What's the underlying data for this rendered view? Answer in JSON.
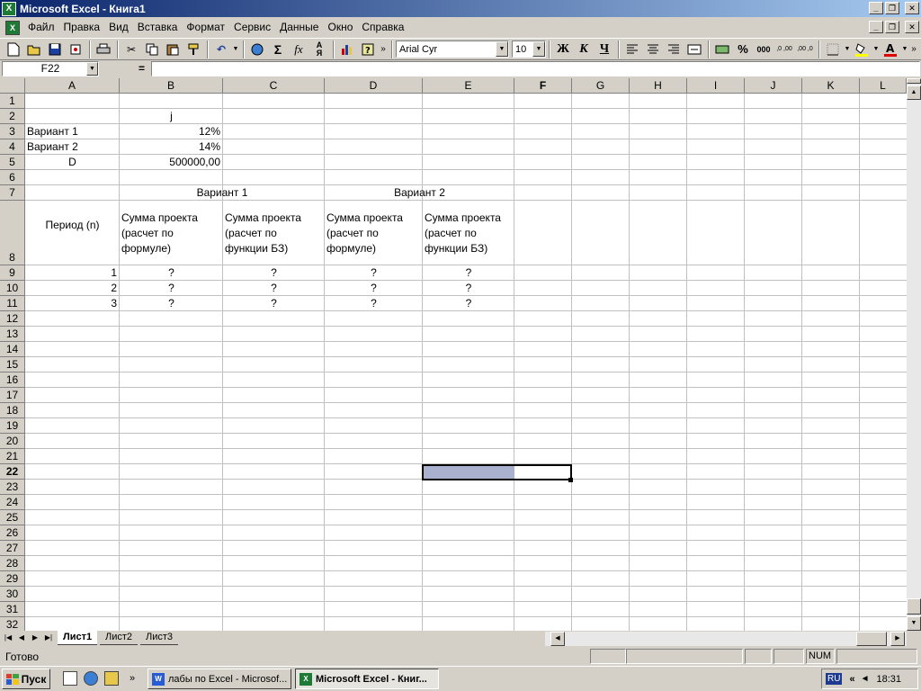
{
  "window": {
    "title": "Microsoft Excel - Книга1"
  },
  "menu": {
    "items": [
      "Файл",
      "Правка",
      "Вид",
      "Вставка",
      "Формат",
      "Сервис",
      "Данные",
      "Окно",
      "Справка"
    ]
  },
  "toolbar": {
    "font_name": "Arial Cyr",
    "font_size": "10",
    "bold_label": "Ж",
    "italic_label": "К",
    "underline_label": "Ч",
    "sum_label": "Σ",
    "fx_label": "fx",
    "percent_label": "%",
    "thousands_label": "000",
    "inc_dec_label": ",0 ,00",
    "dec_dec_label": ",00 ,0"
  },
  "formula_bar": {
    "name_box": "F22",
    "equals": "=",
    "formula": ""
  },
  "grid": {
    "columns": [
      "A",
      "B",
      "C",
      "D",
      "E",
      "F",
      "G",
      "H",
      "I",
      "J",
      "K",
      "L"
    ],
    "rows": [
      "1",
      "2",
      "3",
      "4",
      "5",
      "6",
      "7",
      "8",
      "9",
      "10",
      "11",
      "12",
      "13",
      "14",
      "15",
      "16",
      "17",
      "18",
      "19",
      "20",
      "21",
      "22",
      "23",
      "24",
      "25",
      "26",
      "27",
      "28",
      "29",
      "30",
      "31",
      "32"
    ],
    "cells": {
      "B2": "j",
      "A3": "Вариант 1",
      "B3": "12%",
      "A4": "Вариант 2",
      "B4": "14%",
      "A5": "D",
      "B5": "500000,00",
      "B7": "Вариант 1",
      "D7": "Вариант 2",
      "A8": "Период (n)",
      "B8": "Сумма проекта (расчет по формуле)",
      "C8": "Сумма проекта (расчет по функции БЗ)",
      "D8": "Сумма проекта (расчет по формуле)",
      "E8": "Сумма проекта (расчет по функции БЗ)",
      "A9": "1",
      "B9": "?",
      "C9": "?",
      "D9": "?",
      "E9": "?",
      "A10": "2",
      "B10": "?",
      "C10": "?",
      "D10": "?",
      "E10": "?",
      "A11": "3",
      "B11": "?",
      "C11": "?",
      "D11": "?",
      "E11": "?"
    },
    "active_cell": "F22",
    "selection_color": "#a9b1cf"
  },
  "sheets": {
    "tabs": [
      "Лист1",
      "Лист2",
      "Лист3"
    ],
    "active": "Лист1"
  },
  "status": {
    "text": "Готово",
    "num_indicator": "NUM"
  },
  "taskbar": {
    "start_label": "Пуск",
    "tasks": [
      {
        "label": "лабы по Excel - Microsof..."
      },
      {
        "label": "Microsoft Excel - Книг..."
      }
    ],
    "language": "RU",
    "chevron": "«",
    "quick_chevron": "»",
    "clock": "18:31"
  },
  "colors": {
    "title_start": "#0a246a",
    "title_end": "#a6caf0",
    "excel_green": "#1e7b35",
    "chrome": "#d4d0c8"
  }
}
